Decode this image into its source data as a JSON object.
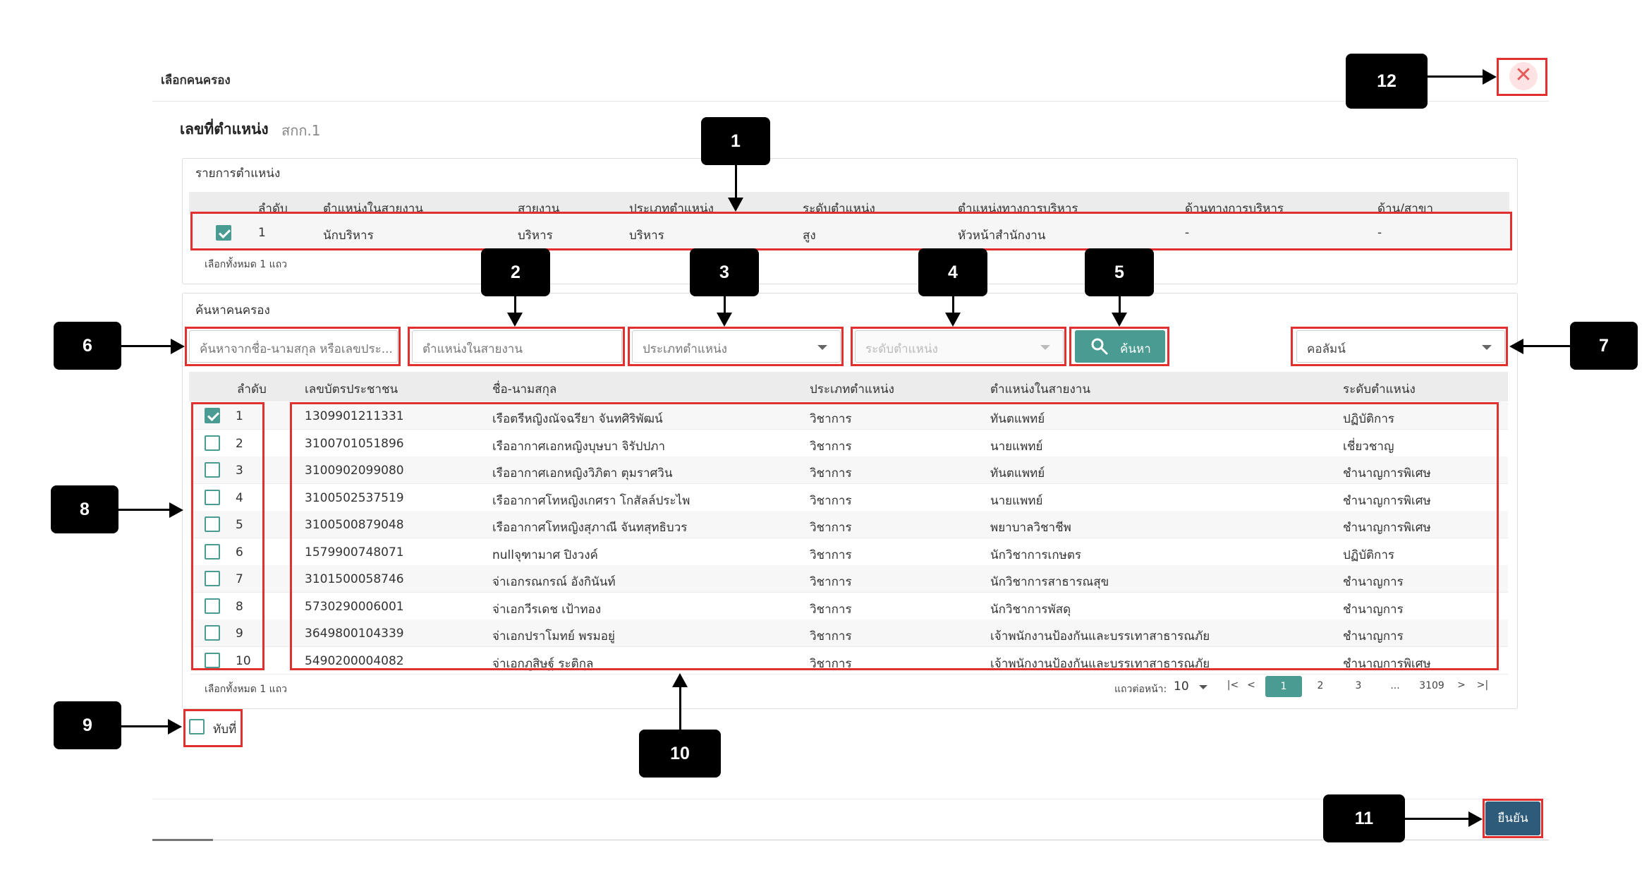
{
  "dialog": {
    "title": "เลือกคนครอง",
    "position_label": "เลขที่ตำแหน่ง",
    "position_value": "สกก.1"
  },
  "position_list": {
    "heading": "รายการตำแหน่ง",
    "columns": [
      "ลำดับ",
      "ตำแหน่งในสายงาน",
      "สายงาน",
      "ประเภทตำแหน่ง",
      "ระดับตำแหน่ง",
      "ตำแหน่งทางการบริหาร",
      "ด้านทางการบริหาร",
      "ด้าน/สาขา"
    ],
    "row": {
      "checked": true,
      "index": "1",
      "position": "นักบริหาร",
      "line": "บริหาร",
      "type": "บริหาร",
      "level": "สูง",
      "admin_position": "หัวหน้าสำนักงาน",
      "admin_side": "-",
      "branch": "-"
    },
    "selected_note": "เลือกทั้งหมด 1 แถว"
  },
  "search": {
    "heading": "ค้นหาคนครอง",
    "name_placeholder": "ค้นหาจากชื่อ-นามสกุล หรือเลขประ...",
    "position_placeholder": "ตำแหน่งในสายงาน",
    "type_placeholder": "ประเภทตำแหน่ง",
    "level_placeholder": "ระดับตำแหน่ง",
    "search_button": "ค้นหา",
    "column_select": "คอลัมน์"
  },
  "results": {
    "columns": [
      "ลำดับ",
      "เลขบัตรประชาชน",
      "ชื่อ-นามสกุล",
      "ประเภทตำแหน่ง",
      "ตำแหน่งในสายงาน",
      "ระดับตำแหน่ง"
    ],
    "rows": [
      {
        "checked": true,
        "no": "1",
        "id": "1309901211331",
        "name": "เรือตรีหญิงณัจฉรียา จันทศิริพัฒน์",
        "type": "วิชาการ",
        "position": "ทันตแพทย์",
        "level": "ปฏิบัติการ"
      },
      {
        "checked": false,
        "no": "2",
        "id": "3100701051896",
        "name": "เรืออากาศเอกหญิงบุษบา จิรัปปภา",
        "type": "วิชาการ",
        "position": "นายแพทย์",
        "level": "เชี่ยวชาญ"
      },
      {
        "checked": false,
        "no": "3",
        "id": "3100902099080",
        "name": "เรืออากาศเอกหญิงวิภิตา ตุมราศวิน",
        "type": "วิชาการ",
        "position": "ทันตแพทย์",
        "level": "ชำนาญการพิเศษ"
      },
      {
        "checked": false,
        "no": "4",
        "id": "3100502537519",
        "name": "เรืออากาศโทหญิงเกศรา โกสัลล์ประไพ",
        "type": "วิชาการ",
        "position": "นายแพทย์",
        "level": "ชำนาญการพิเศษ"
      },
      {
        "checked": false,
        "no": "5",
        "id": "3100500879048",
        "name": "เรืออากาศโทหญิงสุภาณี จันทสุทธิบวร",
        "type": "วิชาการ",
        "position": "พยาบาลวิชาชีพ",
        "level": "ชำนาญการพิเศษ"
      },
      {
        "checked": false,
        "no": "6",
        "id": "1579900748071",
        "name": "nullจุฑามาศ ปิงวงค์",
        "type": "วิชาการ",
        "position": "นักวิชาการเกษตร",
        "level": "ปฏิบัติการ"
      },
      {
        "checked": false,
        "no": "7",
        "id": "3101500058746",
        "name": "จ่าเอกรณกรณ์ อังกินันท์",
        "type": "วิชาการ",
        "position": "นักวิชาการสาธารณสุข",
        "level": "ชำนาญการ"
      },
      {
        "checked": false,
        "no": "8",
        "id": "5730290006001",
        "name": "จ่าเอกวีรเดช เป้าทอง",
        "type": "วิชาการ",
        "position": "นักวิชาการพัสดุ",
        "level": "ชำนาญการ"
      },
      {
        "checked": false,
        "no": "9",
        "id": "3649800104339",
        "name": "จ่าเอกปราโมทย์ พรมอยู่",
        "type": "วิชาการ",
        "position": "เจ้าพนักงานป้องกันและบรรเทาสาธารณภัย",
        "level": "ชำนาญการ"
      },
      {
        "checked": false,
        "no": "10",
        "id": "5490200004082",
        "name": "จ่าเอกภูสิษฐ์ ระติกุล",
        "type": "วิชาการ",
        "position": "เจ้าพนักงานป้องกันและบรรเทาสาธารณภัย",
        "level": "ชำนาญการพิเศษ"
      }
    ],
    "selected_note": "เลือกทั้งหมด 1 แถว",
    "rows_per_page_label": "แถวต่อหน้า:",
    "rows_per_page": "10",
    "pages": [
      "1",
      "2",
      "3",
      "...",
      "3109"
    ],
    "current_page": "1",
    "first_icon": "|<",
    "prev_icon": "<",
    "next_icon": ">",
    "last_icon": ">|"
  },
  "replace_checkbox_label": "ทับที่",
  "confirm_button": "ยืนยัน",
  "close_icon": "✕",
  "callouts": [
    "1",
    "2",
    "3",
    "4",
    "5",
    "6",
    "7",
    "8",
    "9",
    "10",
    "11",
    "12"
  ],
  "colors": {
    "accent": "#4a9b92",
    "confirm": "#2e5b7a",
    "highlight": "#e03030",
    "close_bg": "#fde3e3"
  }
}
